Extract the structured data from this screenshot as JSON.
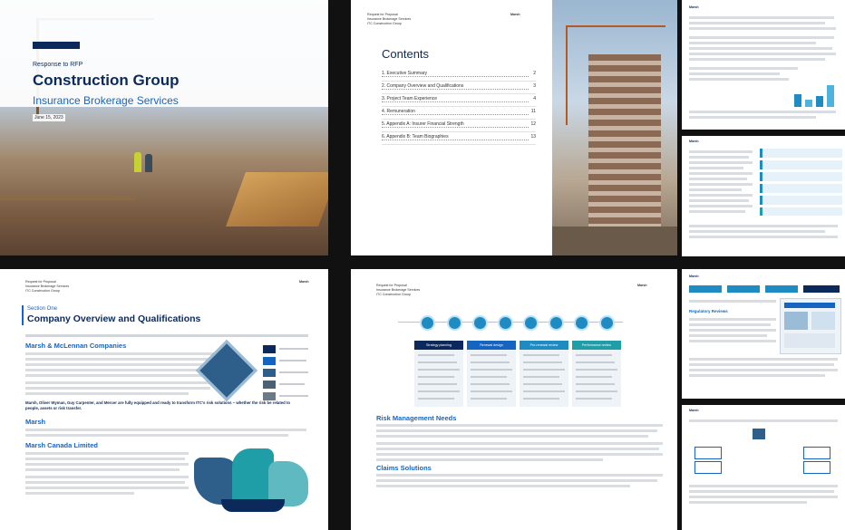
{
  "cover": {
    "label": "Response to RFP",
    "title": "Construction Group",
    "subtitle": "Insurance Brokerage Services",
    "date": "June 15, 2023"
  },
  "toc_page": {
    "header_lines": [
      "Request for Proposal",
      "Insurance Brokerage Services",
      "ITC Construction Group"
    ],
    "brand": "Marsh",
    "heading": "Contents",
    "entries": [
      {
        "label": "1.  Executive Summary",
        "page": "2"
      },
      {
        "label": "2.  Company Overview and Qualifications",
        "page": "3"
      },
      {
        "label": "3.  Project Team Experience",
        "page": "4"
      },
      {
        "label": "4.  Remuneration",
        "page": "11"
      },
      {
        "label": "5.  Appendix A: Insurer Financial Strength",
        "page": "12"
      },
      {
        "label": "6.  Appendix B: Team Biographies",
        "page": "13"
      }
    ]
  },
  "section_page": {
    "header_lines": [
      "Request for Proposal",
      "Insurance Brokerage Services",
      "ITC Construction Group"
    ],
    "brand": "Marsh",
    "section_label": "Section One",
    "title": "Company Overview and Qualifications",
    "heading_1": "Marsh & McLennan Companies",
    "bold_note": "Marsh, Oliver Wyman, Guy Carpenter, and Mercer are fully equipped and ready to transform ITC's risk solutions – whether the risk be related to people, assets or risk transfer.",
    "heading_2": "Marsh",
    "heading_3": "Marsh Canada Limited"
  },
  "risk_page": {
    "header_lines": [
      "Request for Proposal",
      "Insurance Brokerage Services",
      "ITC Construction Group"
    ],
    "brand": "Marsh",
    "timeline_columns": [
      "Strategy planning",
      "Renewal design",
      "Pre-renewal review",
      "Performance review"
    ],
    "column_colors": [
      "#0b2a5b",
      "#1565c0",
      "#1e8bc3",
      "#1f9ea8"
    ],
    "heading_1": "Risk Management Needs",
    "heading_2": "Claims Solutions"
  },
  "side_pages": {
    "brand": "Marsh",
    "heading": "Regulatory Reviews"
  }
}
